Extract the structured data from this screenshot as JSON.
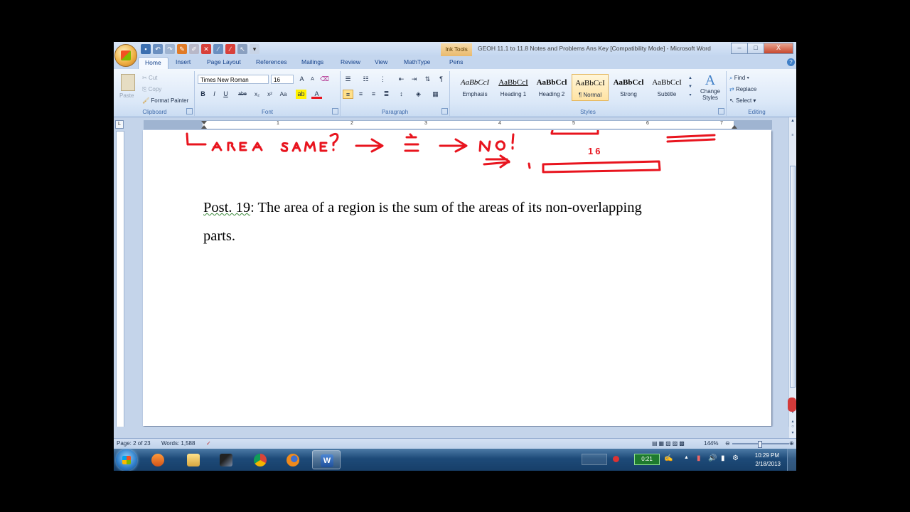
{
  "window": {
    "title": "GEOH 11.1 to 11.8 Notes and Problems Ans Key [Compatibility Mode] - Microsoft Word",
    "context_tab": "Ink Tools",
    "buttons": {
      "minimize": "–",
      "maximize": "□",
      "close": "X"
    }
  },
  "tabs": [
    "Home",
    "Insert",
    "Page Layout",
    "References",
    "Mailings",
    "Review",
    "View",
    "MathType",
    "Pens"
  ],
  "ribbon": {
    "clipboard": {
      "paste": "Paste",
      "cut": "Cut",
      "copy": "Copy",
      "format_painter": "Format Painter",
      "label": "Clipboard"
    },
    "font": {
      "name": "Times New Roman",
      "size": "16",
      "label": "Font",
      "buttons": [
        "B",
        "I",
        "U",
        "abe",
        "x₂",
        "x²",
        "Aa"
      ]
    },
    "paragraph": {
      "label": "Paragraph"
    },
    "styles": {
      "label": "Styles",
      "items": [
        {
          "preview": "AaBbCcI",
          "name": "Emphasis"
        },
        {
          "preview": "AaBbCcI",
          "name": "Heading 1"
        },
        {
          "preview": "AaBbCcl",
          "name": "Heading 2"
        },
        {
          "preview": "AaBbCcI",
          "name": "¶ Normal"
        },
        {
          "preview": "AaBbCcl",
          "name": "Strong"
        },
        {
          "preview": "AaBbCcI",
          "name": "Subtitle"
        }
      ],
      "change_styles": "Change Styles"
    },
    "editing": {
      "find": "Find",
      "replace": "Replace",
      "select": "Select",
      "label": "Editing"
    }
  },
  "ruler": {
    "numbers": [
      "1",
      "2",
      "3",
      "4",
      "5",
      "6",
      "7"
    ]
  },
  "document": {
    "ink_number": "16",
    "post_label": "Post. 19",
    "post_text": ":  The area of a region is the sum of the areas of its non-overlapping",
    "post_text2": "parts."
  },
  "status": {
    "page": "Page: 2 of 23",
    "words": "Words: 1,588",
    "zoom": "144%"
  },
  "taskbar": {
    "timer": "0:21",
    "time": "10:29 PM",
    "date": "2/18/2013"
  },
  "colors": {
    "ink": "#e8141e",
    "ribbon_text": "#15428b"
  }
}
